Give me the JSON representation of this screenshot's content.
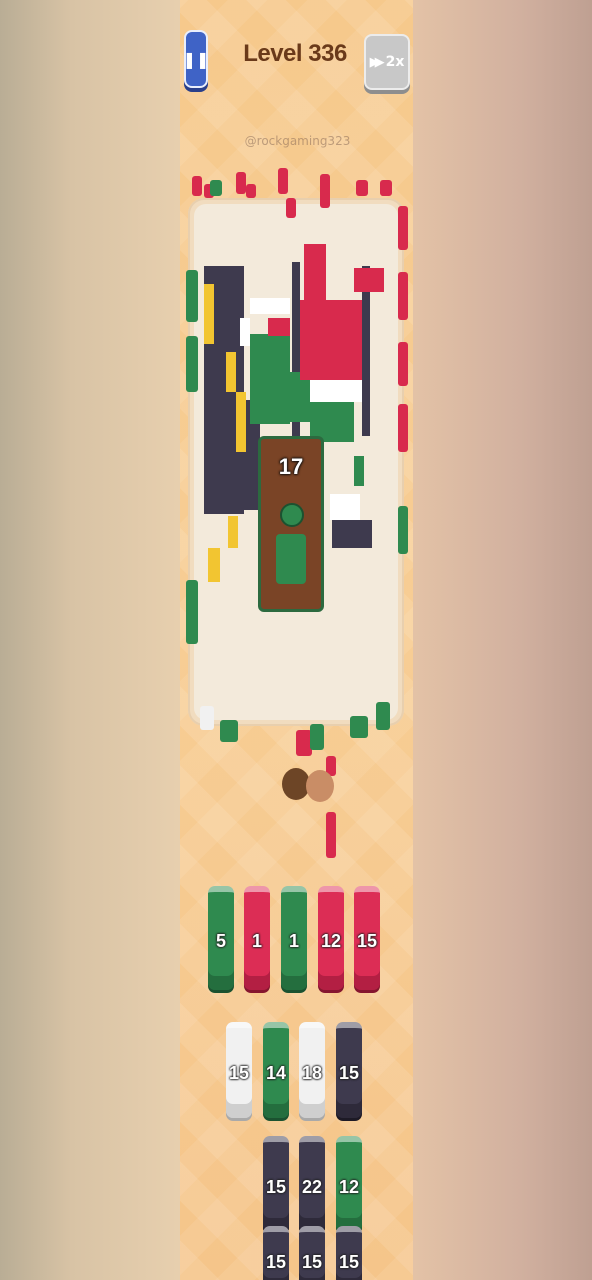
{
  "header": {
    "pause_icon": "pause-icon",
    "pause_glyph": "❚❚",
    "level_title": "Level 336",
    "speed_label": "2x",
    "speed_icon": "fast-forward-icon"
  },
  "watermark": "@rockgaming323",
  "board": {
    "active_block_count": "17"
  },
  "slots": [
    {
      "value": "5",
      "color": "green"
    },
    {
      "value": "1",
      "color": "red"
    },
    {
      "value": "1",
      "color": "green"
    },
    {
      "value": "12",
      "color": "red"
    },
    {
      "value": "15",
      "color": "red"
    }
  ],
  "queue_rows": [
    [
      {
        "value": "15",
        "color": "white"
      },
      {
        "value": "14",
        "color": "green"
      },
      {
        "value": "18",
        "color": "white"
      },
      {
        "value": "15",
        "color": "dark"
      }
    ],
    [
      {
        "value": "15",
        "color": "dark"
      },
      {
        "value": "22",
        "color": "dark"
      },
      {
        "value": "12",
        "color": "green"
      }
    ],
    [
      {
        "value": "15",
        "color": "dark"
      },
      {
        "value": "15",
        "color": "dark"
      },
      {
        "value": "15",
        "color": "dark"
      }
    ]
  ],
  "colors": {
    "green": "#2f8a4f",
    "red": "#dc2d55",
    "white": "#f1f1f1",
    "dark": "#3e3a4e",
    "yellow": "#f2c531",
    "brown": "#7a4426"
  }
}
